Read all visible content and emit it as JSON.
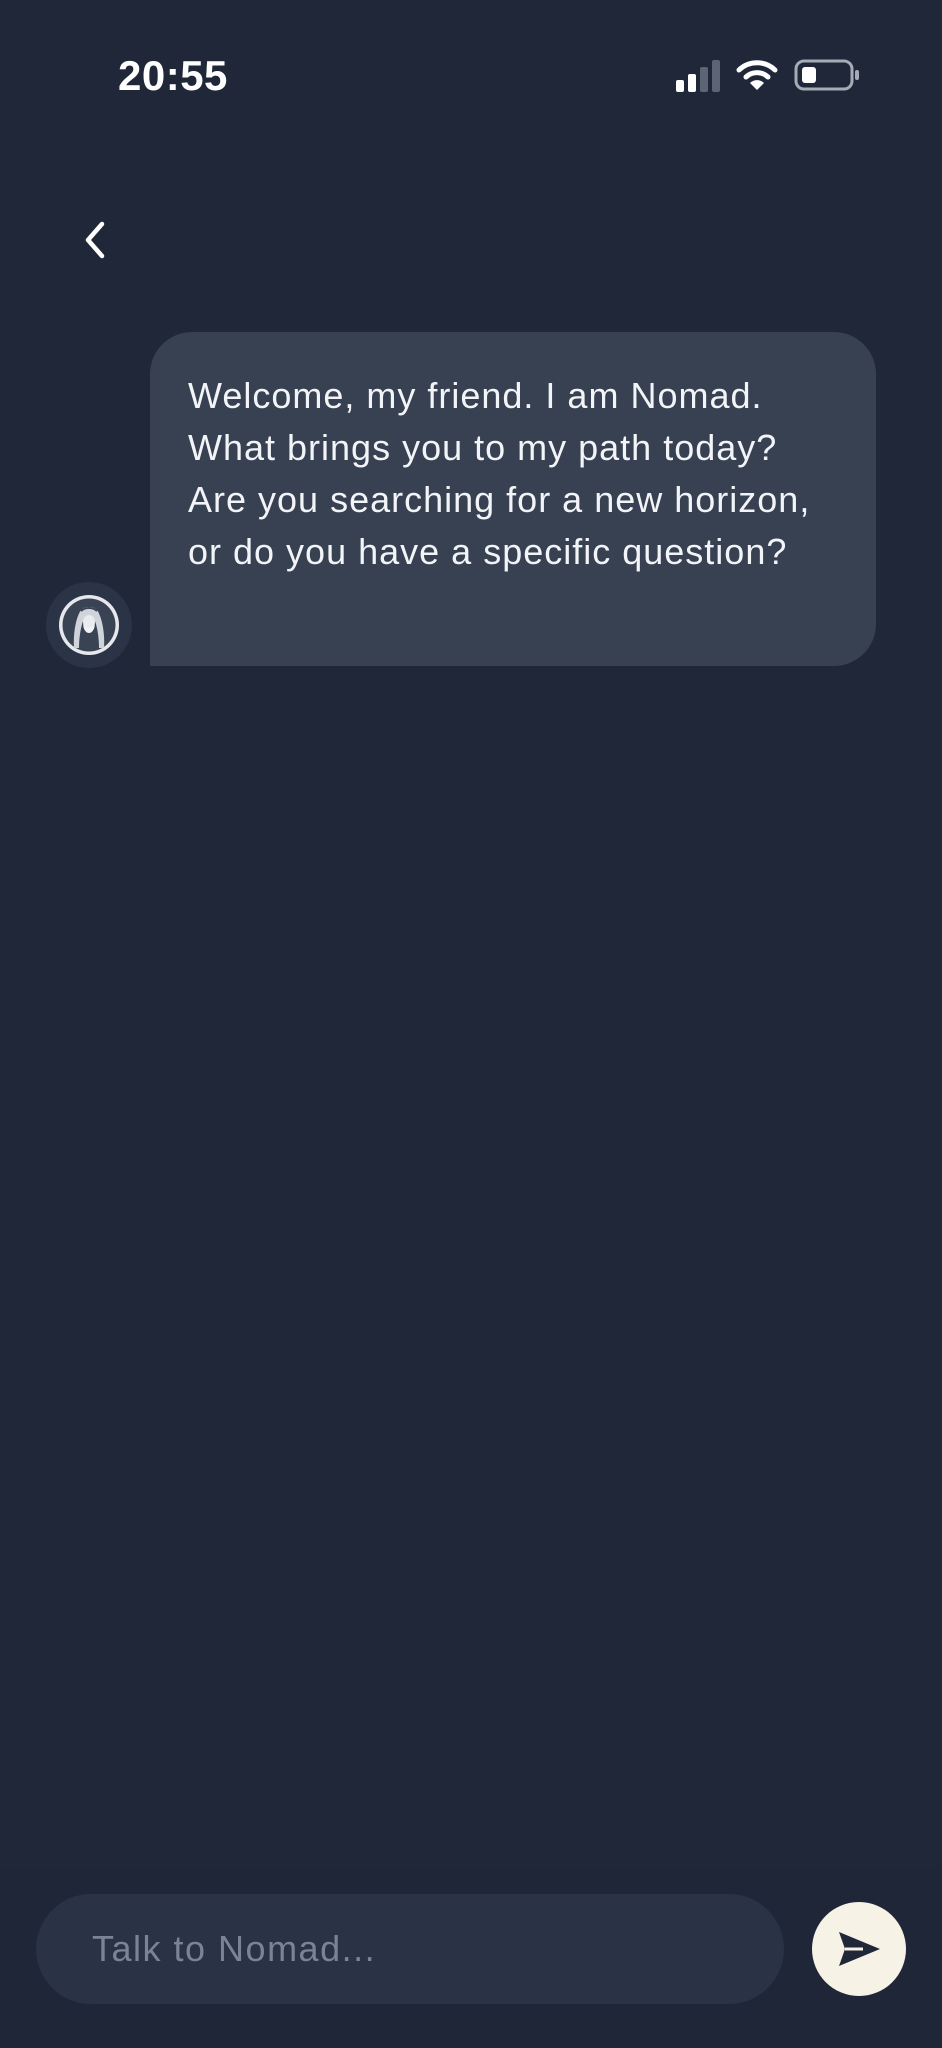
{
  "status_bar": {
    "time": "20:55",
    "signal_icon": "cellular-signal-icon",
    "wifi_icon": "wifi-icon",
    "battery_icon": "battery-low-icon",
    "signal_bars_active": 2,
    "signal_bars_total": 4
  },
  "header": {
    "back_icon": "chevron-left-icon"
  },
  "conversation": {
    "messages": [
      {
        "sender_avatar": "nomad-avatar",
        "text": "Welcome, my friend. I am Nomad. What brings you to my path today? Are you searching for a new horizon, or do you have a specific question?"
      }
    ]
  },
  "composer": {
    "placeholder": "Talk to Nomad...",
    "value": "",
    "send_icon": "send-icon"
  },
  "colors": {
    "background": "#1f2739",
    "bubble": "#374152",
    "input": "#293345",
    "send_button": "#f7f2e6",
    "placeholder": "#7b8494"
  }
}
